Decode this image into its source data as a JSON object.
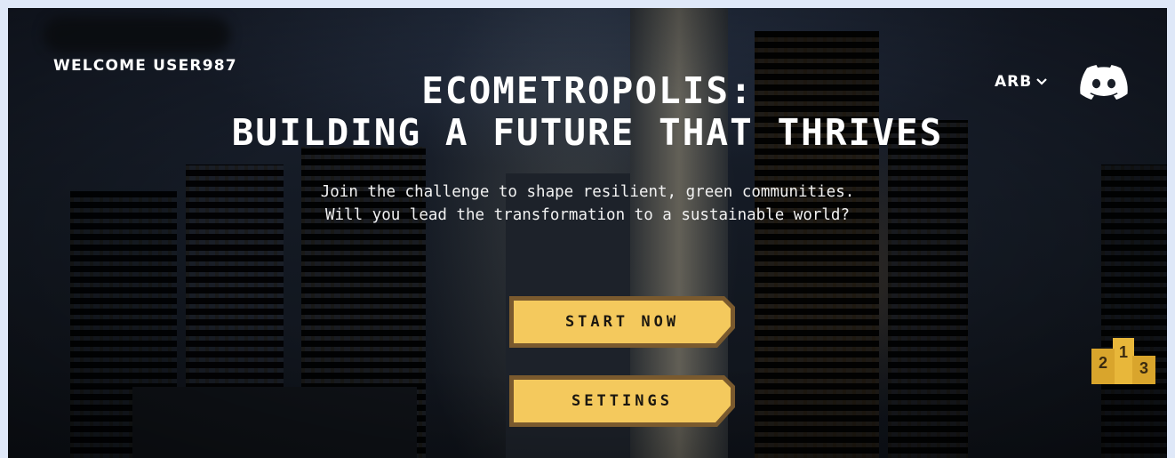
{
  "header": {
    "welcome_text": "WELCOME USER987",
    "language_label": "ARB"
  },
  "hero": {
    "title_line1": "ECOMETROPOLIS:",
    "title_line2": "BUILDING A FUTURE THAT THRIVES",
    "subtitle_line1": "Join the challenge to shape resilient, green communities.",
    "subtitle_line2": "Will you lead the transformation to a sustainable world?"
  },
  "actions": {
    "start_label": "START NOW",
    "settings_label": "SETTINGS"
  },
  "leaderboard": {
    "ranks": [
      "2",
      "1",
      "3"
    ]
  },
  "icons": {
    "discord": "discord-icon",
    "language_chevron": "chevron-down-icon",
    "leaderboard": "podium-icon"
  },
  "colors": {
    "button_fill": "#f4c95d",
    "button_border": "#7a5a2e",
    "podium": "#e8b73a",
    "text": "#ffffff"
  }
}
